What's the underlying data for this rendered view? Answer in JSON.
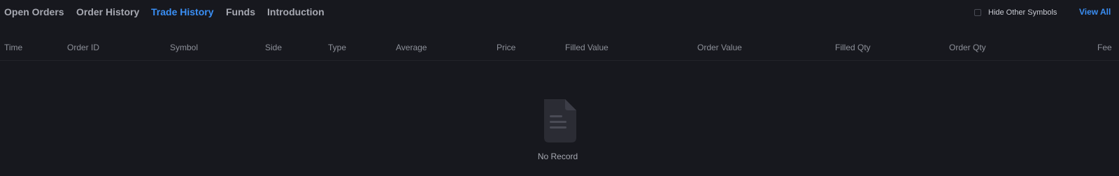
{
  "tabs": [
    {
      "label": "Open Orders",
      "active": false
    },
    {
      "label": "Order History",
      "active": false
    },
    {
      "label": "Trade History",
      "active": true
    },
    {
      "label": "Funds",
      "active": false
    },
    {
      "label": "Introduction",
      "active": false
    }
  ],
  "options": {
    "hide_other_symbols_label": "Hide Other Symbols",
    "hide_other_symbols_checked": false,
    "view_all_label": "View All"
  },
  "table": {
    "columns": [
      "Time",
      "Order ID",
      "Symbol",
      "Side",
      "Type",
      "Average",
      "Price",
      "Filled Value",
      "Order Value",
      "Filled Qty",
      "Order Qty",
      "Fee"
    ],
    "rows": []
  },
  "empty_state": {
    "icon": "document-icon",
    "text": "No Record"
  },
  "colors": {
    "background": "#17181e",
    "accent": "#3a8ff5",
    "tab_inactive": "#a6a8b1",
    "column_header": "#8d9099"
  }
}
